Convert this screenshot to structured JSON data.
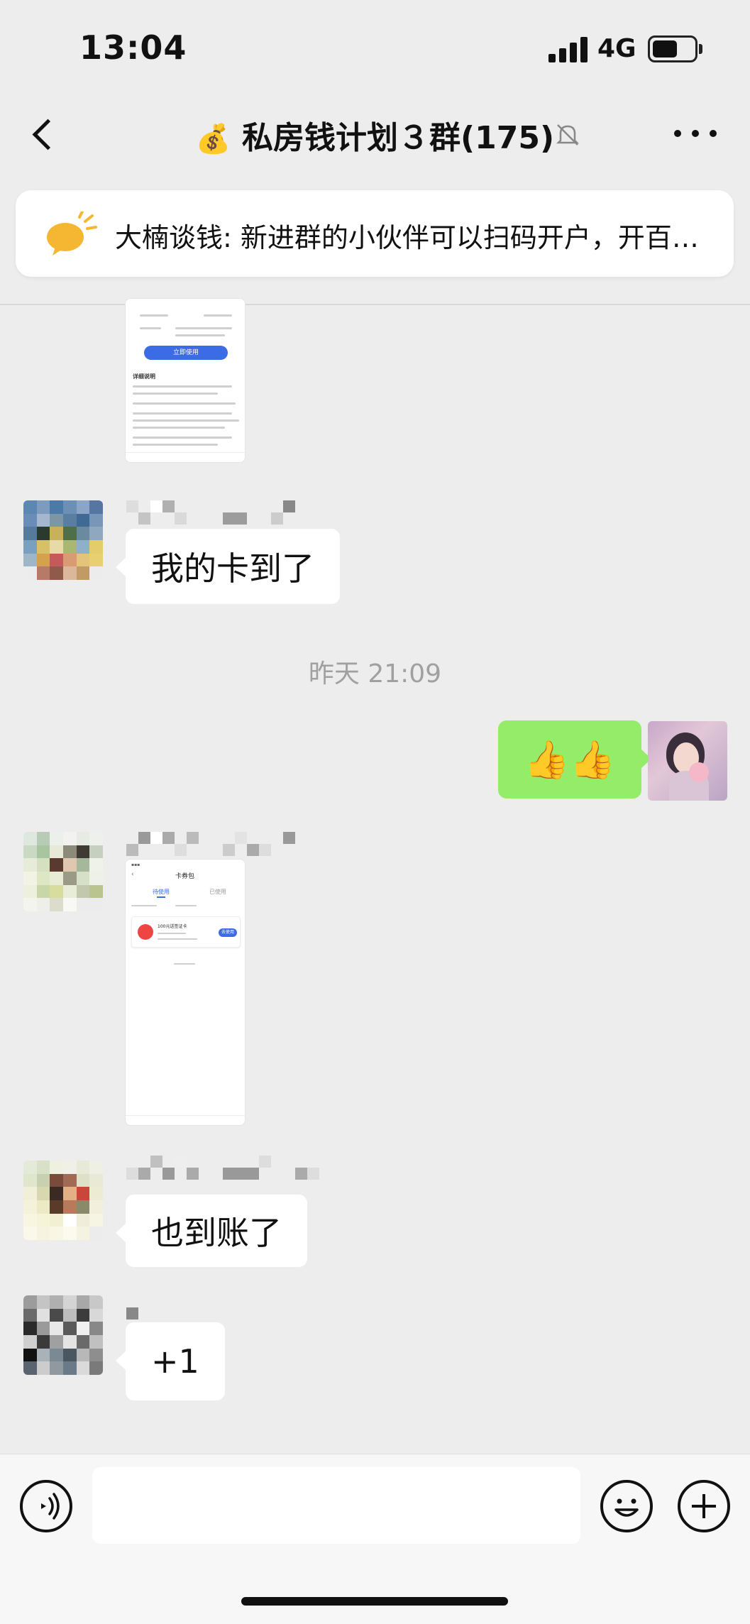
{
  "status": {
    "time": "13:04",
    "network": "4G",
    "battery_level": 0.55
  },
  "header": {
    "title_emoji": "💰",
    "title": "私房钱计划３群(175)"
  },
  "pinned": {
    "text": "大楠谈钱: 新进群的小伙伴可以扫码开户，开百…"
  },
  "messages": {
    "m1_shot": {
      "button": "立即使用",
      "section": "详细说明"
    },
    "m2": {
      "text": "我的卡到了"
    },
    "timestamp": "昨天 21:09",
    "m3": {
      "text": "👍👍"
    },
    "m4_shot": {
      "title": "卡券包",
      "tab_pending": "待使用",
      "tab_used": "已使用",
      "card_name": "100元送签证卡",
      "card_btn": "去使用"
    },
    "m5": {
      "text": "也到账了"
    },
    "m6": {
      "text": "+1"
    }
  },
  "colors": {
    "bubble_self": "#95ec69",
    "background": "#ededed"
  }
}
